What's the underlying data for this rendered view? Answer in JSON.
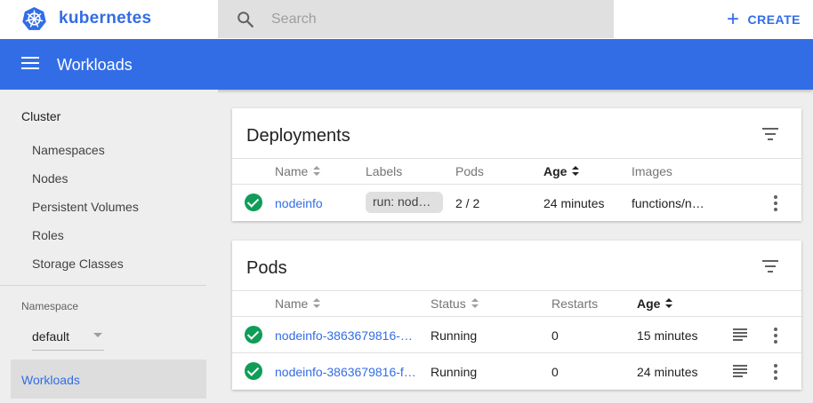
{
  "app": {
    "brand": "kubernetes",
    "create_label": "CREATE"
  },
  "search": {
    "placeholder": "Search",
    "value": ""
  },
  "header": {
    "title": "Workloads"
  },
  "sidebar": {
    "heading": "Cluster",
    "items": [
      {
        "label": "Namespaces"
      },
      {
        "label": "Nodes"
      },
      {
        "label": "Persistent Volumes"
      },
      {
        "label": "Roles"
      },
      {
        "label": "Storage Classes"
      }
    ],
    "namespace_label": "Namespace",
    "namespace_value": "default",
    "active_item": "Workloads"
  },
  "deployments": {
    "title": "Deployments",
    "columns": {
      "name": "Name",
      "labels": "Labels",
      "pods": "Pods",
      "age": "Age",
      "images": "Images"
    },
    "rows": [
      {
        "status": "ok",
        "name": "nodeinfo",
        "labels": "run: node…",
        "pods": "2 / 2",
        "age": "24 minutes",
        "images": "functions/n…"
      }
    ]
  },
  "pods": {
    "title": "Pods",
    "columns": {
      "name": "Name",
      "status": "Status",
      "restarts": "Restarts",
      "age": "Age"
    },
    "rows": [
      {
        "status_icon": "ok",
        "name": "nodeinfo-3863679816-…",
        "status": "Running",
        "restarts": "0",
        "age": "15 minutes"
      },
      {
        "status_icon": "ok",
        "name": "nodeinfo-3863679816-f…",
        "status": "Running",
        "restarts": "0",
        "age": "24 minutes"
      }
    ]
  },
  "icons": {
    "logo": "kubernetes-helm-wheel-icon",
    "search": "search-icon",
    "create": "plus-icon",
    "menu": "hamburger-menu-icon",
    "filter": "filter-icon",
    "status_ok": "check-circle-icon",
    "more": "more-vert-icon",
    "logs": "logs-icon"
  },
  "colors": {
    "accent": "#326de6",
    "success": "#0f9d58"
  }
}
